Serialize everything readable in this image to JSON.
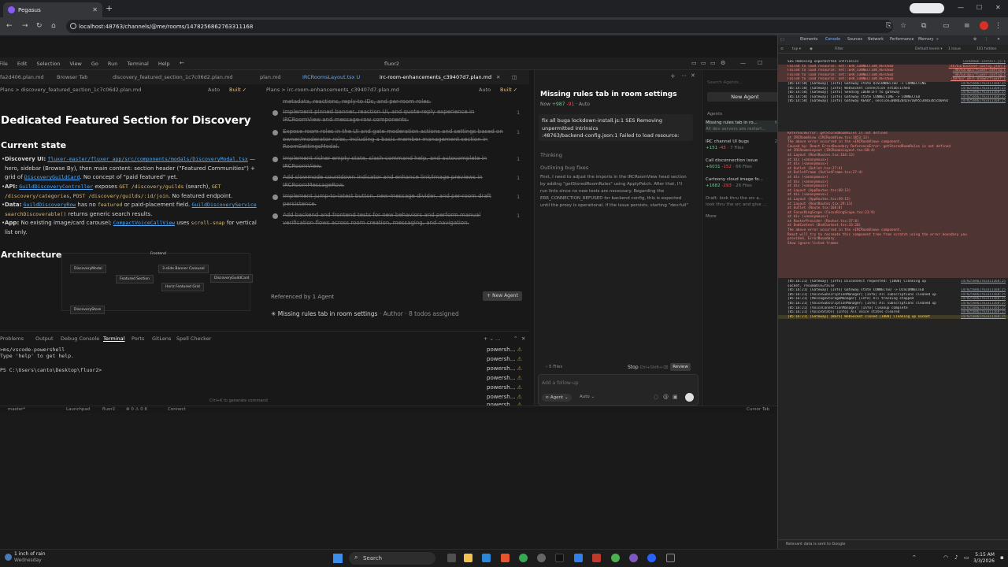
{
  "browser": {
    "tab_title": "Pegasus",
    "url": "localhost:48763/channels/@me/rooms/1478256862763311168",
    "profile_label": "Paused"
  },
  "ide": {
    "app_title": "fluor2",
    "menu": [
      "File",
      "Edit",
      "Selection",
      "View",
      "Go",
      "Run",
      "Terminal",
      "Help"
    ],
    "editor_tabs": [
      "fa2d406.plan.md",
      "Browser Tab",
      "discovery_featured_section_1c7c06d2.plan.md",
      "plan.md",
      "IRCRoomsLayout.tsx U",
      "irc-room-enhancements_c39407d7.plan.md"
    ],
    "left_breadcrumb": "Plans > discovery_featured_section_1c7c06d2.plan.md",
    "mid_breadcrumb": "Plans > irc-room-enhancements_c39407d7.plan.md",
    "auto_label": "Auto",
    "built_label": "Built ✓",
    "doc": {
      "title": "Dedicated Featured Section for Discovery",
      "current_state": "Current state",
      "b1_label": "Discovery UI:",
      "b1_link": "fluxer-master/fluxer_app/src/components/modals/DiscoveryModal.tsx",
      "b1_text": "— hero, sidebar (Browse By), then main content: section header (\"Featured Communities\") + grid of",
      "b1_link2": "DiscoveryGuildCard",
      "b1_text2": ". No concept of \"paid featured\" yet.",
      "b2_label": "API:",
      "b2_link": "GuildDiscoveryController",
      "b2_text": "exposes",
      "b2_code1": "GET /discovery/guilds",
      "b2_text2": "(search),",
      "b2_code2": "GET /discovery/categories",
      "b2_code3": "POST /discovery/guilds/:id/join",
      "b2_text3": ". No featured endpoint.",
      "b3_label": "Data:",
      "b3_link": "GuildDiscoveryRow",
      "b3_text": "has no",
      "b3_code": "featured",
      "b3_text2": "or paid-placement field.",
      "b3_link2": "GuildDiscoveryService",
      "b3_code2": "searchDiscoverable()",
      "b3_text3": "returns generic search results.",
      "b4_label": "App:",
      "b4_text": "No existing image/card carousel;",
      "b4_link": "CompactVoiceCallView",
      "b4_text2": "uses",
      "b4_code": "scroll-snap",
      "b4_text3": "for vertical list only.",
      "architecture": "Architecture",
      "diagram_nodes": [
        "Frontend",
        "DiscoveryModal",
        "Featured Section",
        "3-slide Banner Carousel",
        "Horiz Featured Grid",
        "DiscoveryGuildCard",
        "DiscoveryStore"
      ]
    },
    "todos": [
      "metadata, reactions, reply-to IDs, and per-room roles.",
      "Implement pinned banner, reaction UI, and quote-reply experience in IRCRoomView and message-row components.",
      "Expose room roles in the UI and gate moderation actions and settings based on owner/moderator roles, including a basic member management section in RoomSettingsModal.",
      "Implement richer empty state, slash-command help, and autocomplete in IRCRoomView.",
      "Add slowmode countdown indicator and enhance link/image previews in IRCRoomMessageRow.",
      "Implement jump-to-latest button, new-message divider, and per-room draft persistence.",
      "Add backend and frontend tests for new behaviors and perform manual verification flows across room creation, messaging, and navigation."
    ],
    "todo_num": "1",
    "referenced_by": "Referenced by 1 Agent",
    "new_agent_small": "+ New Agent",
    "ref_item_title": "Missing rules tab in room settings",
    "ref_item_meta": "· Author · 8 todos assigned",
    "panel_tabs": [
      "Problems",
      "Output",
      "Debug Console",
      "Terminal",
      "Ports",
      "GitLens",
      "Spell Checker"
    ],
    "terminal_lines": [
      ">ms/vscode-powershell",
      "Type 'help' to get help.",
      "",
      "PS C:\\Users\\canto\\Desktop\\fluor2>"
    ],
    "pwsh_items": [
      "powersh...",
      "powersh...",
      "powersh...",
      "powersh...",
      "powersh...",
      "powersh...",
      "powersh..."
    ],
    "term_hint": "Ctrl+K to generate command",
    "status": {
      "branch": "master*",
      "launchpad": "Launchpad",
      "project": "fluor2",
      "counts": "⊗ 0 ⚠ 0  6",
      "connect": "Connect",
      "cursor_tab": "Cursor Tab"
    }
  },
  "chat": {
    "title": "Missing rules tab in room settings",
    "meta_now": "Now",
    "meta_plus": "+987",
    "meta_minus": "-91",
    "meta_auto": "· Auto",
    "user_msg": "fix all buga lockdown-install.js:1 SES Removing unpermitted intrinsics\n:48763/backend-config.json:1  Failed to load resource:",
    "thinking": "Thinking",
    "outlining": "Outlining bug fixes",
    "body": "First, I need to adjust the imports in the IRCRoomView head section by adding \"getStoredRoomRules\" using ApplyPatch. After that, I'll run lints since no new tests are necessary. Regarding the ERR_CONNECTION_REFUSED for backend config, this is expected until the proxy is operational. If the issue persists, starting \"dev:full\"",
    "files": "› 5 Files",
    "stop": "Stop",
    "stop_hint": "Ctrl+Shift+⌫",
    "review": "Review",
    "placeholder": "Add a follow-up",
    "agent_pill": "∞ Agent ⌄",
    "auto": "Auto ⌄"
  },
  "agents": {
    "search_placeholder": "Search Agents...",
    "new_agent": "New Agent",
    "label": "Agents",
    "items": [
      {
        "title": "Missing rules tab in ro...",
        "sub": "All dev servers are restart...",
        "time": "Now"
      },
      {
        "title": "IRC channel UI bugs",
        "sub_plus": "+151",
        "sub_minus": "-45",
        "sub_rest": "· 7 Files",
        "time": "23m"
      },
      {
        "title": "Call disconnection issue",
        "sub_plus": "+6031",
        "sub_minus": "-152",
        "sub_rest": "· 66 Files",
        "time": "8h"
      },
      {
        "title": "Cartoony cloud image fo...",
        "sub_plus": "+1682",
        "sub_minus": "-293",
        "sub_rest": "· 26 Files",
        "time": "8h"
      },
      {
        "title": "Draft: look thru the src a...",
        "sub": "look thru the src and give ...",
        "time": "8h"
      },
      {
        "title": "More",
        "sub": "",
        "time": ""
      }
    ]
  },
  "devtools": {
    "tabs": [
      "Elements",
      "Console",
      "Sources",
      "Network",
      "Performance",
      "Memory",
      "»"
    ],
    "filter_top": "top ▾",
    "filter": "Filter",
    "default_levels": "Default levels ▾",
    "issues": "1 Issue",
    "hidden": "101 hidden",
    "logs": [
      {
        "cls": "",
        "text": "SES Removing unpermitted intrinsics",
        "src": "lockdown-install.js:1"
      },
      {
        "cls": "err",
        "text": "Failed to load resource: net::ERR_CONNECTION_REFUSED",
        "src": ":48763/backend-config.json:1"
      },
      {
        "cls": "err",
        "text": "Failed to load resource: net::ERR_CONNECTION_REFUSED",
        "src": ":48763/api/fluxer-config:1"
      },
      {
        "cls": "err",
        "text": "Failed to load resource: net::ERR_CONNECTION_REFUSED",
        "src": ":48763/api/fluxer-config:1"
      },
      {
        "cls": "err",
        "text": "Failed to load resource: net::ERR_CONNECTION_REFUSED",
        "src": ":48763/.well-known/fluxer:1"
      },
      {
        "cls": "",
        "text": "[05:14:58] [Gateway] [Info] Gateway state DISCONNECTED -> CONNECTING",
        "src": "1478256862763311168:25"
      },
      {
        "cls": "",
        "text": "[05:14:58] [Gateway] [Info] WebSocket connection established",
        "src": "1478256862763311168:25"
      },
      {
        "cls": "",
        "text": "[05:14:58] [Gateway] [Info] Sending IDENTIFY to gateway",
        "src": "1478256862763311168:25"
      },
      {
        "cls": "",
        "text": "[05:14:58] [Gateway] [Info] Gateway state CONNECTING -> CONNECTED",
        "src": "1478256862763311168:25"
      },
      {
        "cls": "",
        "text": "[05:14:58] [Gateway] [Info] Gateway READY, session=008b2042e7a0955384a3b5cb0e92",
        "src": "1478256862763311168:25"
      }
    ],
    "stack": [
      "ReferenceError: getStoredRoomRules is not defined",
      "    at IRCRoomView (IRCRoomView.tsx:1853:13)",
      "The above error occurred in the <IRCRoomView> component.",
      "Caused by: React ErrorBoundary ReferenceError: getStoredRoomRules is not defined",
      "    at IRCRoomsLayout (IRCRoomsLayout.tsx:68:4)",
      "    at Layout (RootRoutes.tsx:164:13)",
      "    at div (<anonymous>)",
      "    at div (<anonymous>)",
      "    at Outlet (Outlet.tsx:27:4)",
      "    at OutletFrame (OutletFrame.tsx:27:4)",
      "    at div (<anonymous>)",
      "    at div (<anonymous>)",
      "    at div (<anonymous>)",
      "    at Layout (AppRoutes.tsx:60:13)",
      "    at div (<anonymous>)",
      "    at Layout (AppRoutes.tsx:49:13)",
      "    at Layout (RootRoutes.tsx:29:13)",
      "    at Outlet (Route.tsx:168:8)",
      "    at FocusRingScope (FocusRingScope.tsx:23:9)",
      "    at div (<anonymous>)",
      "    at RouterProvider (Router.tsx:37:8)",
      "    at DndContext (DndContext.tsx:33:20)",
      "",
      "The above error occurred in the <IRCRoomView> component.",
      "",
      "React will try to recreate this component tree from scratch using the error boundary you",
      "provided, ErrorBoundary.",
      "Show ignore-listed frames"
    ],
    "logs2": [
      {
        "cls": "",
        "text": "[05:16:21] [Gateway] [Info] Disconnect requested: [1000] Cleaning up",
        "src": "1478256862763311168:25"
      },
      {
        "cls": "",
        "text": "socket, resumable=false",
        "src": ""
      },
      {
        "cls": "",
        "text": "[05:16:21] [Gateway] [Info] Gateway state CONNECTED -> DISCONNECTED",
        "src": "1478256862763311168:25"
      },
      {
        "cls": "",
        "text": "[05:16:21] [VoiceSubscriptionManager] [Info] All subscriptions cleaned up",
        "src": "1478256862763311168:25"
      },
      {
        "cls": "",
        "text": "[05:16:21] [MessageStorageManager] [Info] All tracking stopped",
        "src": "1478256862763311168:25"
      },
      {
        "cls": "",
        "text": "[05:16:21] [VoiceSubscriptionManager] [Info] All subscriptions cleaned up",
        "src": "1478256862763311168:25"
      },
      {
        "cls": "",
        "text": "[05:16:21] [VoiceConnectionManager] [Info] Cleanup complete",
        "src": "1478256862763311168:25"
      },
      {
        "cls": "",
        "text": "[05:16:21] [VoiceState] [Info] All voice states cleared",
        "src": "1478256862763311168:25"
      },
      {
        "cls": "warn",
        "text": "[05:16:21] [Gateway] [Warn] WebSocket closed [1000] Cleaning up socket",
        "src": "1478256862763311168:25"
      }
    ],
    "bottom": "Relevant data is sent to Google"
  },
  "taskbar": {
    "weather_line1": "1 inch of rain",
    "weather_line2": "Wednesday",
    "search": "Search",
    "time": "5:15 AM",
    "date": "3/3/2026"
  }
}
